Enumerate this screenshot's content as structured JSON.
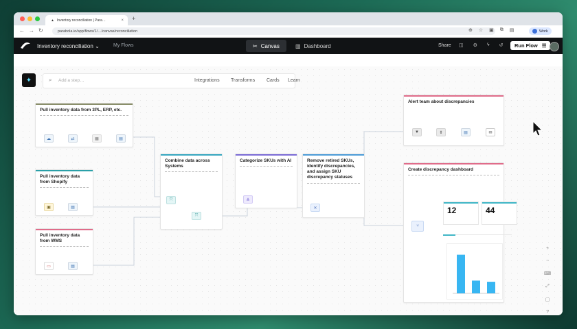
{
  "browser": {
    "tab_title": "Inventory reconciliation | Para…",
    "url": "parabola.io/app/flows/1/…/canvas/reconciliation",
    "profile_label": "Work"
  },
  "app": {
    "title": "Inventory reconciliation",
    "my_flows": "My Flows",
    "canvas_label": "Canvas",
    "dashboard_label": "Dashboard",
    "share_label": "Share",
    "run_flow_label": "Run Flow"
  },
  "toolbar": {
    "search_placeholder": "Add a step…",
    "nav": [
      "Integrations",
      "Transforms",
      "Cards",
      "Learn"
    ]
  },
  "cards": {
    "pull_3pl": {
      "title": "Pull inventory data from 3PL, ERP, etc.",
      "color": "#8a8f6a"
    },
    "pull_shopify": {
      "title": "Pull inventory data from Shopify",
      "color": "#2aa0a8"
    },
    "pull_wms": {
      "title": "Pull inventory data from WMS",
      "color": "#e06c8a"
    },
    "combine": {
      "title": "Combine data across Systems",
      "color": "#36a7c0"
    },
    "categorize": {
      "title": "Categorize SKUs with AI",
      "color": "#7b6bd6"
    },
    "remove": {
      "title": "Remove retired SKUs, identify discrepancies, and assign SKU discrepancy statuses",
      "color": "#4c9cd8"
    },
    "alert": {
      "title": "Alert team about discrepancies",
      "color": "#e06c8a"
    },
    "dashboard": {
      "title": "Create discrepancy dashboard",
      "color": "#e06c8a"
    }
  },
  "kpis": [
    {
      "value": "12"
    },
    {
      "value": "44"
    }
  ],
  "chart_data": {
    "type": "bar",
    "values": [
      100,
      33,
      30
    ],
    "ylim": [
      0,
      110
    ]
  },
  "colors": {
    "accent_teal": "#3fb6c6",
    "bar_blue": "#38b6f2",
    "wire": "#c9d1dc"
  }
}
